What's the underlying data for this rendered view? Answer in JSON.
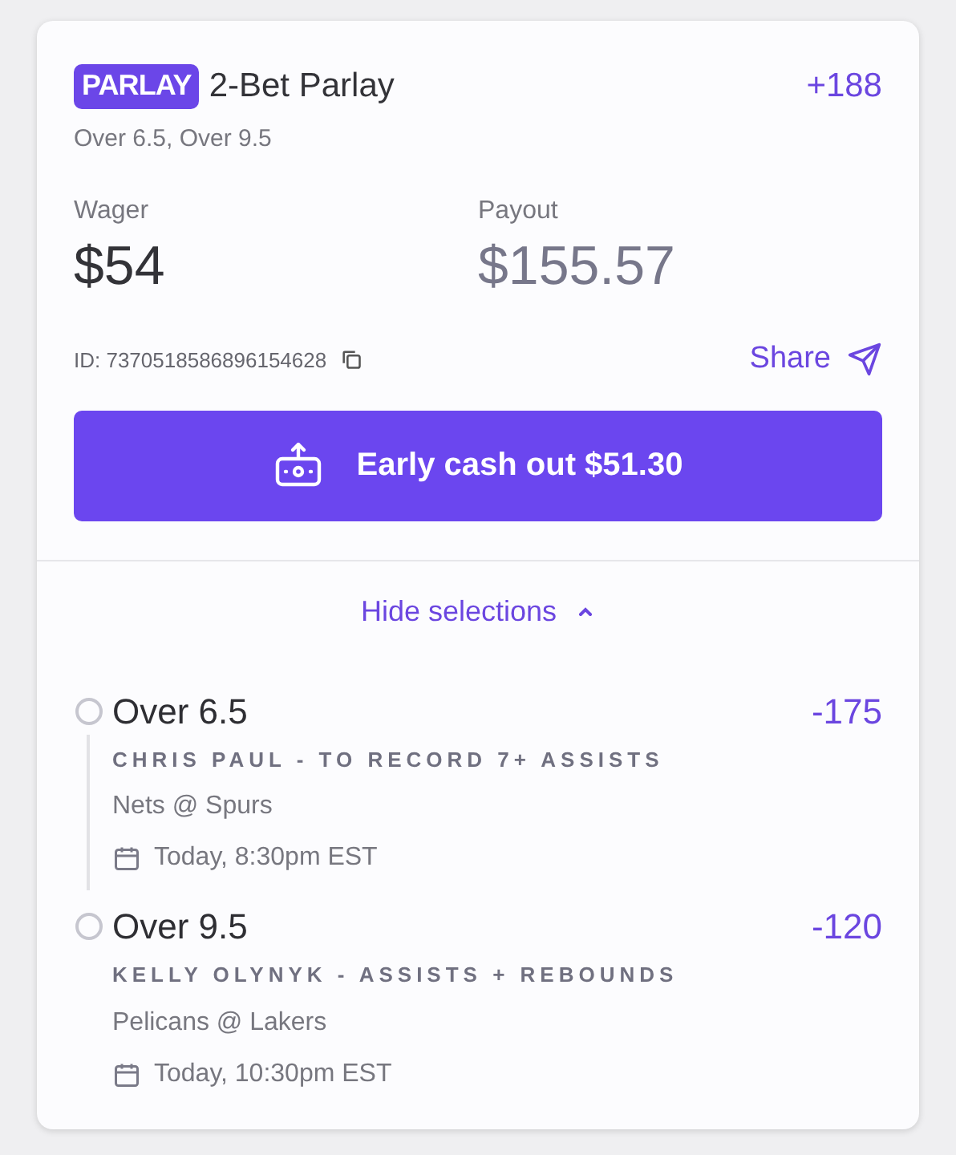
{
  "bet": {
    "badge": "PARLAY",
    "title": "2-Bet Parlay",
    "odds": "+188",
    "summary": "Over 6.5, Over 9.5"
  },
  "wager": {
    "label": "Wager",
    "value": "$54"
  },
  "payout": {
    "label": "Payout",
    "value": "$155.57"
  },
  "bet_id": "ID: 7370518586896154628",
  "share": "Share",
  "cash_out": "Early cash out $51.30",
  "selections_toggle": {
    "label": "Hide selections",
    "expanded": true
  },
  "selections": [
    {
      "pick": "Over 6.5",
      "odds": "-175",
      "market": "CHRIS PAUL - TO RECORD 7+ ASSISTS",
      "matchup": "Nets @ Spurs",
      "time": "Today, 8:30pm EST"
    },
    {
      "pick": "Over 9.5",
      "odds": "-120",
      "market": "KELLY OLYNYK - ASSISTS + REBOUNDS",
      "matchup": "Pelicans @ Lakers",
      "time": "Today, 10:30pm EST"
    }
  ]
}
